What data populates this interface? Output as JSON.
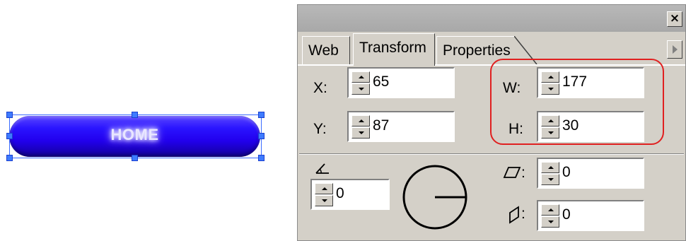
{
  "canvas": {
    "button_label": "HOME",
    "button_color": "#2a14ff"
  },
  "panel": {
    "close_glyph": "×",
    "tabs": [
      {
        "label": "Web",
        "active": false
      },
      {
        "label": "Transform",
        "active": true
      },
      {
        "label": "Properties",
        "active": false
      }
    ],
    "fields": {
      "x": {
        "label": "X:",
        "value": "65"
      },
      "y": {
        "label": "Y:",
        "value": "87"
      },
      "w": {
        "label": "W:",
        "value": "177"
      },
      "h": {
        "label": "H:",
        "value": "30"
      },
      "rotation": {
        "value": "0"
      },
      "skew_h": {
        "value": "0"
      },
      "skew_v": {
        "value": "0"
      }
    },
    "highlight_color": "#e02020"
  }
}
